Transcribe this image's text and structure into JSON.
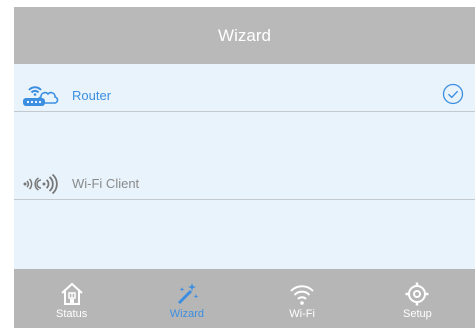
{
  "header": {
    "title": "Wizard"
  },
  "modes": [
    {
      "label": "Router",
      "icon": "router-icon",
      "selected": true
    },
    {
      "label": "Wi-Fi Client",
      "icon": "wifi-client-icon",
      "selected": false
    }
  ],
  "navbar": {
    "items": [
      {
        "label": "Status",
        "icon": "home-icon",
        "active": false
      },
      {
        "label": "Wizard",
        "icon": "wand-icon",
        "active": true
      },
      {
        "label": "Wi-Fi",
        "icon": "wifi-icon",
        "active": false
      },
      {
        "label": "Setup",
        "icon": "gear-icon",
        "active": false
      }
    ]
  },
  "colors": {
    "accent": "#3c8fe0",
    "header_bg": "#b9b9b9",
    "content_bg": "#e8f3fb",
    "navbar_bg": "#b6b6b6"
  }
}
